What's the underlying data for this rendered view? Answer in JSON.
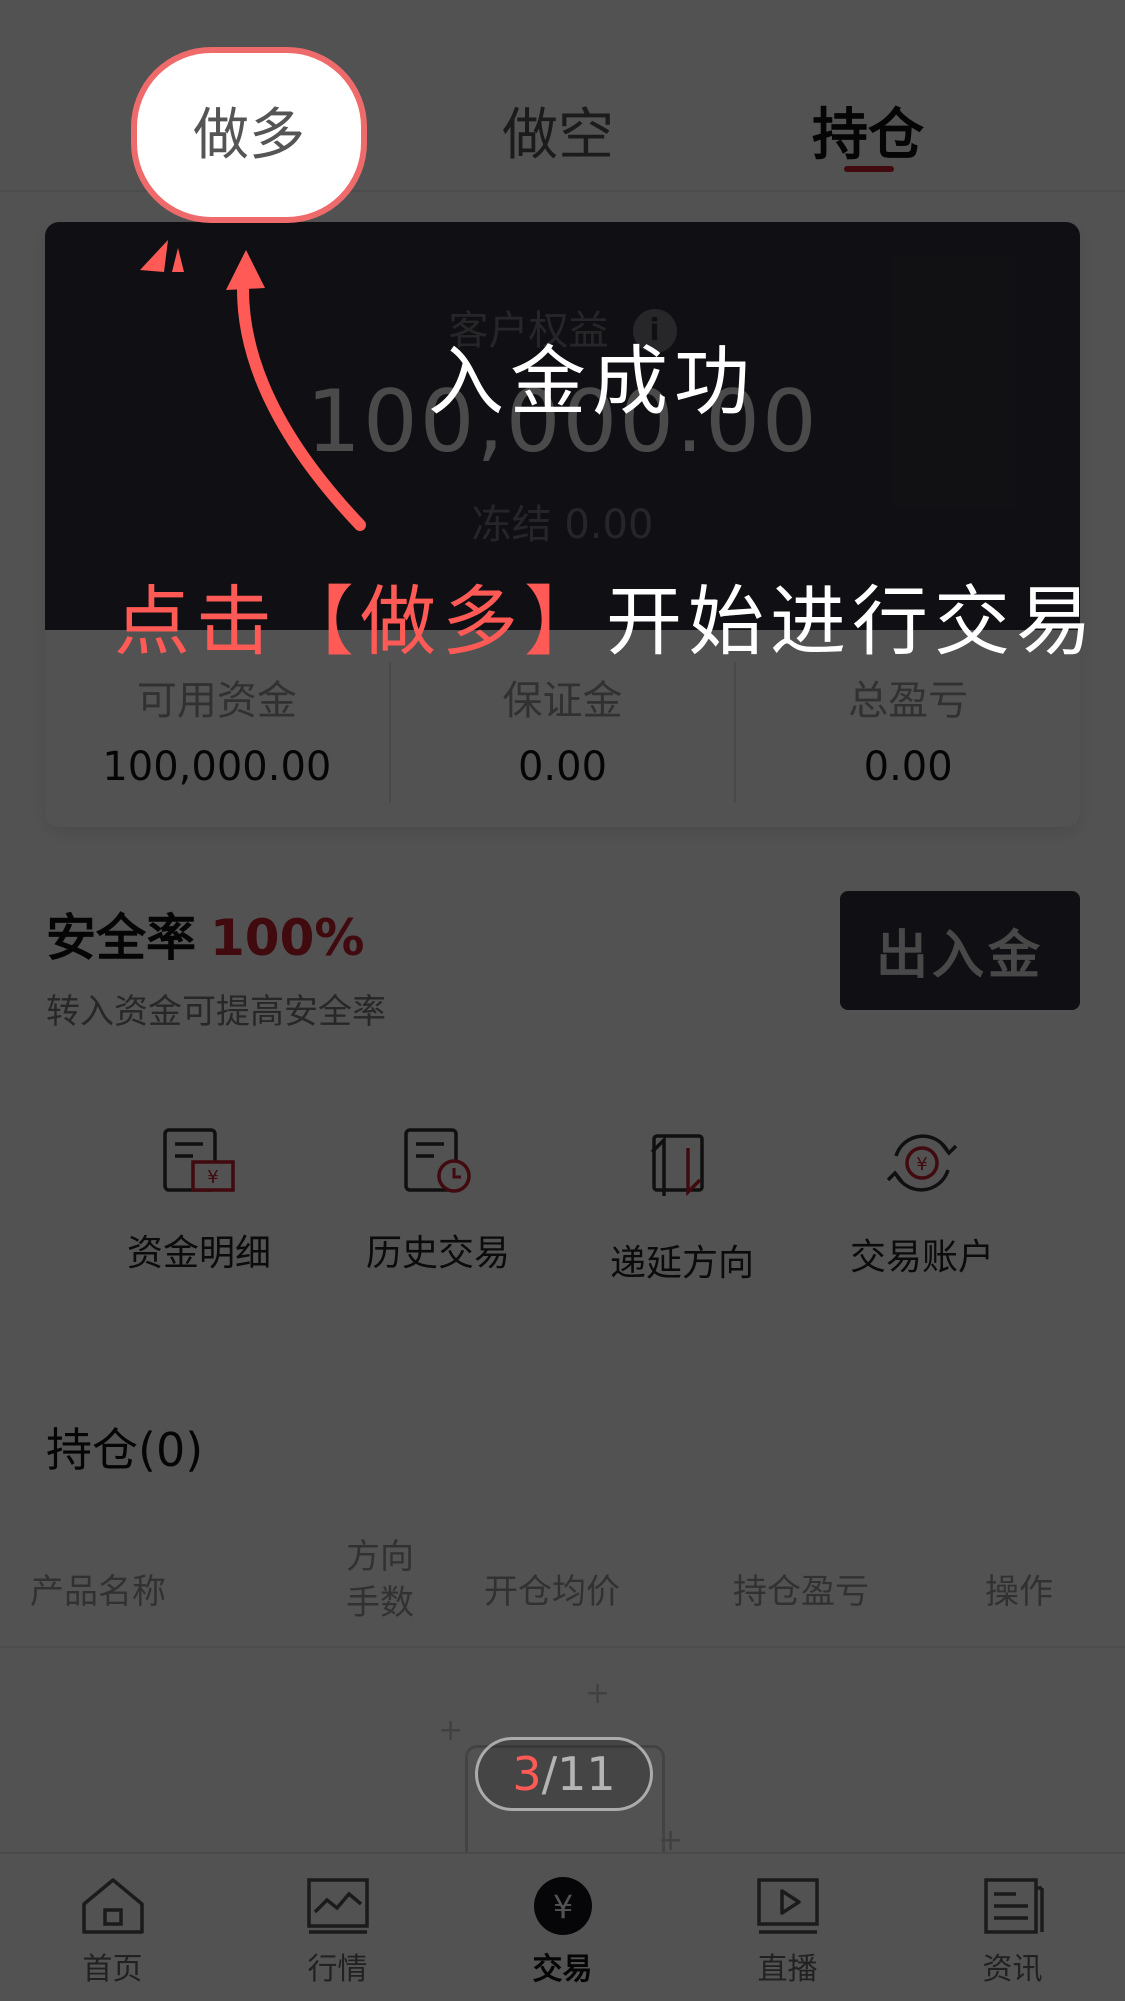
{
  "tabs": {
    "long": "做多",
    "short": "做空",
    "holdings": "持仓"
  },
  "account": {
    "equity_label": "客户权益",
    "equity_value": "100,000.00",
    "frozen_label": "冻结",
    "frozen_value": "0.00",
    "available_label": "可用资金",
    "available_value": "100,000.00",
    "margin_label": "保证金",
    "margin_value": "0.00",
    "pl_label": "总盈亏",
    "pl_value": "0.00"
  },
  "safety": {
    "title": "安全率",
    "rate": "100%",
    "hint": "转入资金可提高安全率",
    "deposit_button": "出入金"
  },
  "shortcuts": [
    {
      "label": "资金明细",
      "icon": "fund-detail-icon"
    },
    {
      "label": "历史交易",
      "icon": "trade-history-icon"
    },
    {
      "label": "递延方向",
      "icon": "deferred-direction-icon"
    },
    {
      "label": "交易账户",
      "icon": "trading-account-icon"
    }
  ],
  "holdings": {
    "title": "持仓(0)",
    "columns": {
      "name": "产品名称",
      "direction": "方向",
      "quantity": "手数",
      "avg_price": "开仓均价",
      "pl": "持仓盈亏",
      "action": "操作"
    }
  },
  "nav": [
    {
      "label": "首页",
      "icon": "home-icon"
    },
    {
      "label": "行情",
      "icon": "market-icon"
    },
    {
      "label": "交易",
      "icon": "trade-yuan-icon"
    },
    {
      "label": "直播",
      "icon": "live-play-icon"
    },
    {
      "label": "资讯",
      "icon": "news-icon"
    }
  ],
  "overlay": {
    "line1": "入金成功",
    "line2_prefix": "点击【做多】",
    "line2_suffix": "开始进行交易",
    "page_current": "3",
    "page_sep": "/",
    "page_total": "11"
  },
  "colors": {
    "accent": "#c8202f",
    "dark_card": "#34343f",
    "tutorial_red": "#ff5a55"
  }
}
